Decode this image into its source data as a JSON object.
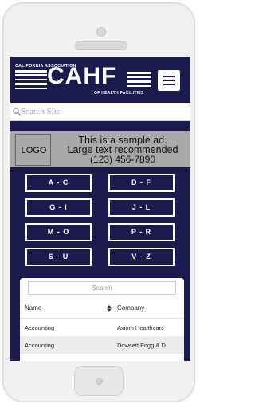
{
  "header": {
    "association_line": "CALIFORNIA ASSOCIATION",
    "logo_text": "CAHF",
    "facilities_line": "OF HEALTH FACILITIES"
  },
  "search": {
    "placeholder": "Search Site"
  },
  "ad": {
    "logo_label": "LOGO",
    "line1": "This is a sample ad.",
    "line2": "Large text recommended",
    "line3": "(123) 456-7890"
  },
  "alphabet": {
    "buttons": [
      "A - C",
      "D - F",
      "G - I",
      "J - L",
      "M - O",
      "P - R",
      "S - U",
      "V - Z"
    ]
  },
  "table": {
    "search_placeholder": "Search",
    "columns": [
      "Name",
      "Company"
    ],
    "rows": [
      {
        "name": "Accounting",
        "company": "Axiom Healthcare"
      },
      {
        "name": "Accounting",
        "company": "Dowsett Fogg & D"
      }
    ]
  },
  "colors": {
    "navy": "#1a1a4c",
    "ad_gray": "#a9a9a9",
    "row_alt": "#ececec"
  }
}
